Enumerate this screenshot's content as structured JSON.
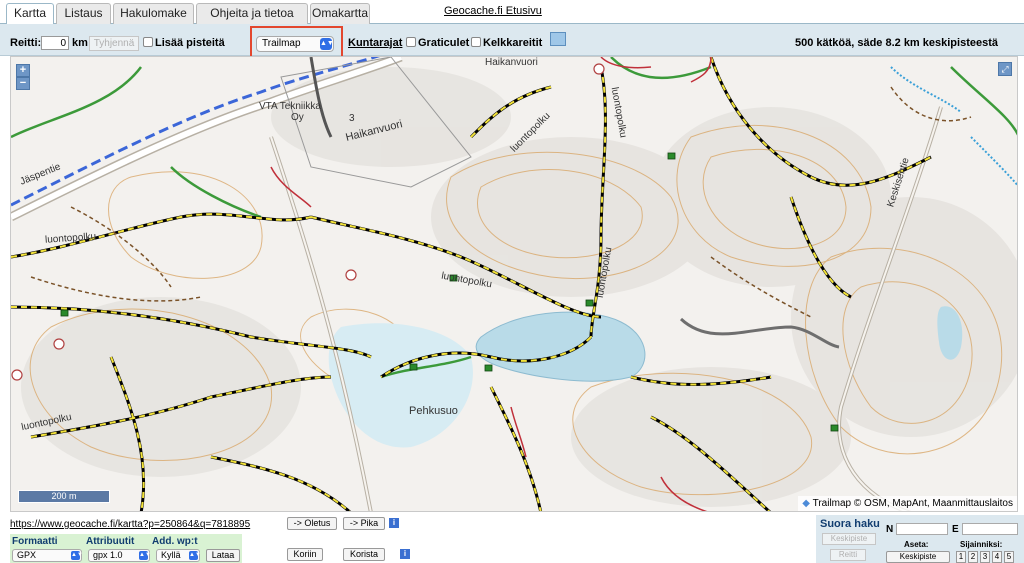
{
  "tabs": [
    "Kartta",
    "Listaus",
    "Hakulomake",
    "Ohjeita ja tietoa",
    "Omakartta"
  ],
  "home_link": "Geocache.fi Etusivu",
  "toolbar": {
    "route_label": "Reitti:",
    "route_value": "0",
    "route_unit": "km",
    "clear_label": "Tyhjennä",
    "add_points_label": "Lisää pisteitä",
    "layer_value": "Trailmap",
    "municipal_label": "Kuntarajat",
    "graticule_label": "Graticulet",
    "sled_label": "Kelkkareitit",
    "status": "500 kätköä, säde 8.2 km keskipisteestä"
  },
  "map": {
    "zoom_in": "+",
    "zoom_out": "−",
    "scale": "200 m",
    "attribution": "Trailmap © OSM, MapAnt, Maanmittauslaitos",
    "labels": {
      "haikanvuori_top": "Haikanvuori",
      "vta": "VTA Tekniikka",
      "oy": "Oy",
      "three": "3",
      "haikanvuori": "Haikanvuori",
      "jaspe": "Jäspentie",
      "luonto1": "luontopolku",
      "luonto2": "luontopolku",
      "luonto3": "luontopolku",
      "luonto4": "luontopolku",
      "luonto5": "luontopolku",
      "luonto6": "luontopolku",
      "keski": "Keskisentie",
      "pehkusuo": "Pehkusuo"
    }
  },
  "bottom": {
    "url": "https://www.geocache.fi/kartta?p=250864&q=7818895",
    "oletus_label": "-> Oletus",
    "pika_label": "-> Pika",
    "formaatti_label": "Formaatti",
    "attribuutit_label": "Attribuutit",
    "addwp_label": "Add. wp:t",
    "format_value": "GPX",
    "attr_value": "gpx 1.0",
    "addwp_value": "Kyllä",
    "lataa_label": "Lataa",
    "koriin_label": "Koriin",
    "korista_label": "Korista",
    "direct_title": "Suora haku",
    "center_label": "Keskipiste",
    "route_btn_label": "Reitti",
    "n_label": "N",
    "e_label": "E",
    "aseta_label": "Aseta:",
    "sijainniksi_label": "Sijainniksi:",
    "keskipiste_btn": "Keskipiste",
    "nums": [
      "1",
      "2",
      "3",
      "4",
      "5"
    ]
  }
}
